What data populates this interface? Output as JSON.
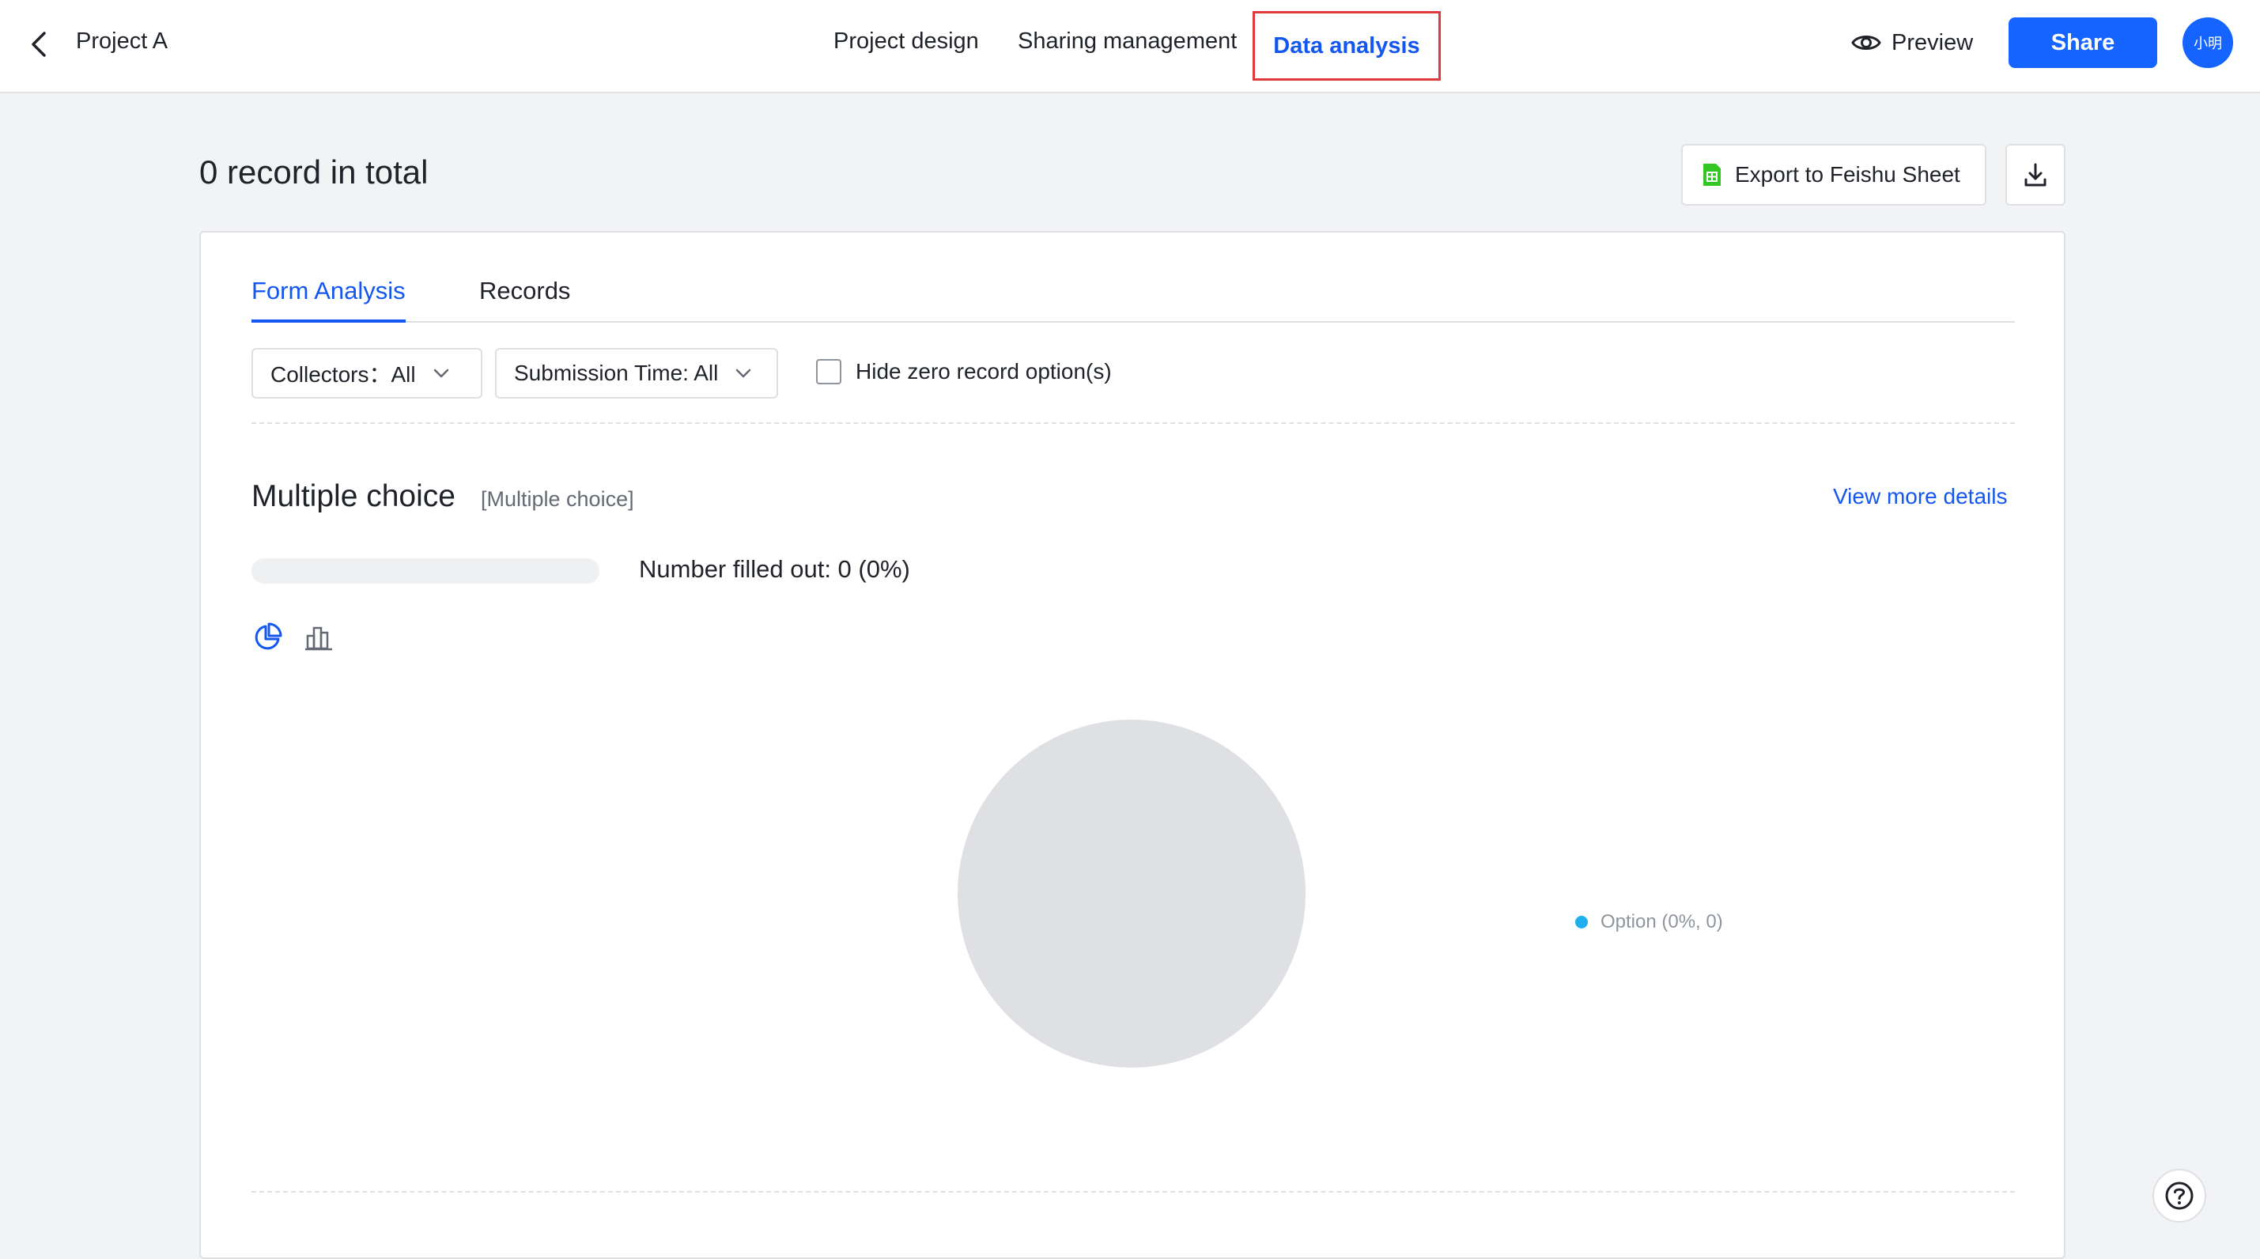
{
  "header": {
    "project_title": "Project A",
    "nav_tabs": [
      {
        "label": "Project design"
      },
      {
        "label": "Sharing management"
      },
      {
        "label": "Data analysis"
      }
    ],
    "preview_label": "Preview",
    "share_label": "Share",
    "avatar_text": "小明"
  },
  "summary": {
    "total_title": "0 record in total",
    "export_label": "Export to Feishu Sheet"
  },
  "tabs": [
    {
      "label": "Form Analysis",
      "active": true
    },
    {
      "label": "Records",
      "active": false
    }
  ],
  "filters": {
    "collectors": "Collectors：All",
    "submission_time": "Submission Time: All",
    "hide_zero_label": "Hide zero record option(s)"
  },
  "question": {
    "title": "Multiple choice",
    "type_tag": "[Multiple choice]",
    "view_more_label": "View more details",
    "filled_text": "Number filled out: 0 (0%)",
    "filled_fraction": 0
  },
  "chart_data": {
    "type": "pie",
    "slices": [
      {
        "name": "Option",
        "value": 0,
        "percent": 0
      }
    ],
    "legend": [
      "Option (0%, 0)"
    ],
    "legend_placement": "right"
  },
  "colors": {
    "accent": "#1456f0",
    "share_button": "#1664ff",
    "highlight_box": "#e0393e",
    "legend_dot": "#20b0f0",
    "empty_pie": "#dee0e3"
  },
  "icons": {
    "back": "chevron-left-icon",
    "preview": "eye-icon",
    "export": "spreadsheet-icon",
    "download": "download-icon",
    "pie_chart": "pie-chart-icon",
    "bar_chart": "bar-chart-icon",
    "help": "question-icon"
  }
}
